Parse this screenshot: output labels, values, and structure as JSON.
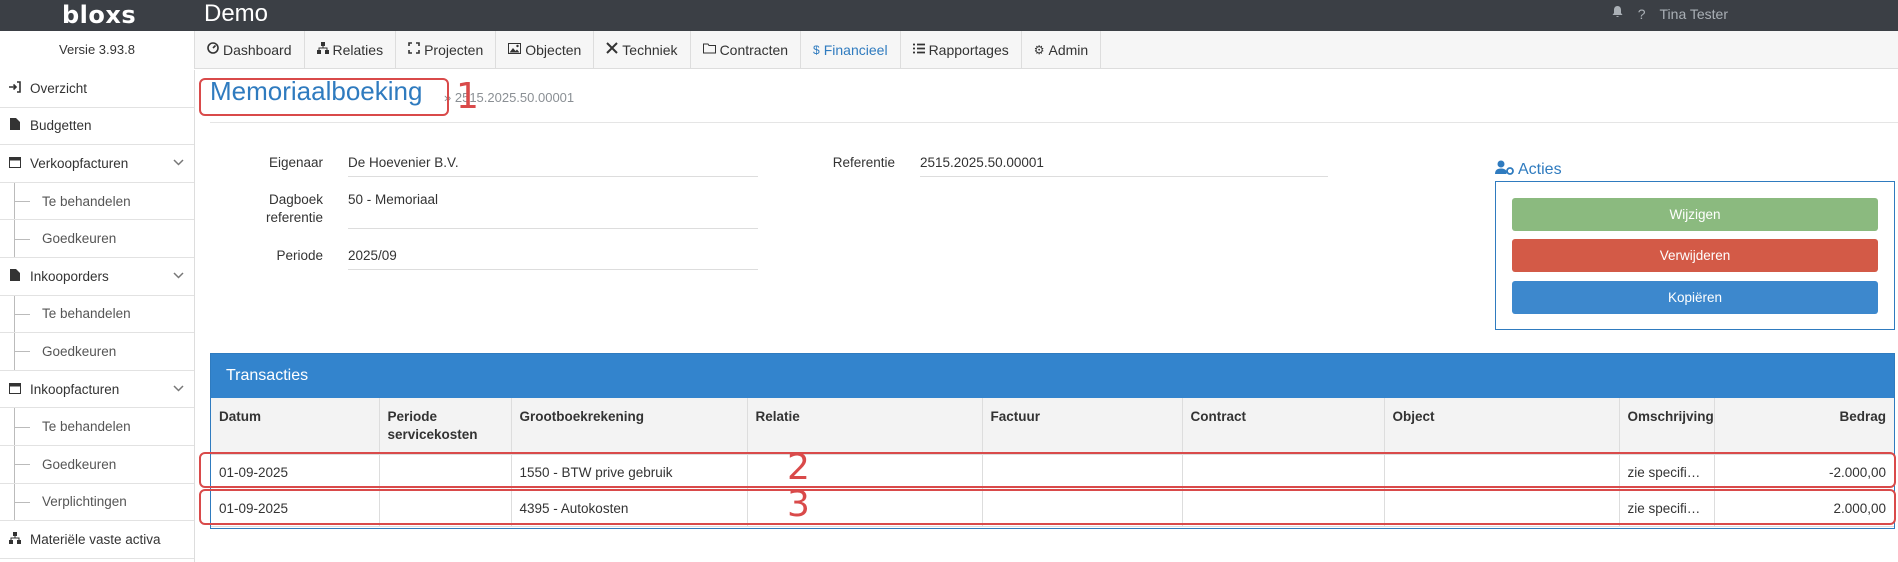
{
  "header": {
    "logo": "bloxs",
    "app_title": "Demo",
    "user_name": "Tina Tester",
    "help_glyph": "?"
  },
  "version": "Versie 3.93.8",
  "menu": [
    {
      "label": "Dashboard",
      "icon": "dashboard-icon"
    },
    {
      "label": "Relaties",
      "icon": "sitemap-icon"
    },
    {
      "label": "Projecten",
      "icon": "expand-icon"
    },
    {
      "label": "Objecten",
      "icon": "image-icon"
    },
    {
      "label": "Techniek",
      "icon": "tools-icon"
    },
    {
      "label": "Contracten",
      "icon": "folder-icon"
    },
    {
      "label": "Financieel",
      "icon": "dollar-icon",
      "active": true
    },
    {
      "label": "Rapportages",
      "icon": "list-icon"
    },
    {
      "label": "Admin",
      "icon": "gear-icon"
    }
  ],
  "sidebar": {
    "items": [
      {
        "label": "Overzicht",
        "icon": "sign-in-icon"
      },
      {
        "label": "Budgetten",
        "icon": "file-icon"
      },
      {
        "label": "Verkoopfacturen",
        "icon": "calendar-icon"
      },
      {
        "label": "Te behandelen"
      },
      {
        "label": "Goedkeuren"
      },
      {
        "label": "Inkooporders",
        "icon": "file-icon"
      },
      {
        "label": "Te behandelen"
      },
      {
        "label": "Goedkeuren"
      },
      {
        "label": "Inkoopfacturen",
        "icon": "calendar-icon"
      },
      {
        "label": "Te behandelen"
      },
      {
        "label": "Goedkeuren"
      },
      {
        "label": "Verplichtingen"
      },
      {
        "label": "Materiële vaste activa",
        "icon": "sitemap-icon"
      }
    ]
  },
  "page": {
    "title": "Memoriaalboeking",
    "breadcrumb": "2515.2025.50.00001"
  },
  "annotations": [
    "1",
    "2",
    "3"
  ],
  "fields": {
    "eigenaar_label": "Eigenaar",
    "eigenaar_value": "De Hoevenier B.V.",
    "dagboek_label_1": "Dagboek",
    "dagboek_label_2": "referentie",
    "dagboek_value": "50 - Memoriaal",
    "periode_label": "Periode",
    "periode_value": "2025/09",
    "referentie_label": "Referentie",
    "referentie_value": "2515.2025.50.00001"
  },
  "acties": {
    "title": "Acties",
    "wijzigen": "Wijzigen",
    "verwijderen": "Verwijderen",
    "kopieren": "Kopiëren",
    "colors": {
      "green": "#8bba7f",
      "red": "#d35a47",
      "blue": "#3d88cd"
    }
  },
  "transacties": {
    "title": "Transacties",
    "columns": [
      "Datum",
      "Periode servicekosten",
      "Grootboekrekening",
      "Relatie",
      "Factuur",
      "Contract",
      "Object",
      "Omschrijving",
      "Bedrag"
    ],
    "rows": [
      [
        "01-09-2025",
        "",
        "1550 - BTW prive gebruik",
        "",
        "",
        "",
        "",
        "zie specifica…",
        "-2.000,00"
      ],
      [
        "01-09-2025",
        "",
        "4395 - Autokosten",
        "",
        "",
        "",
        "",
        "zie specifica…",
        "2.000,00"
      ]
    ]
  }
}
